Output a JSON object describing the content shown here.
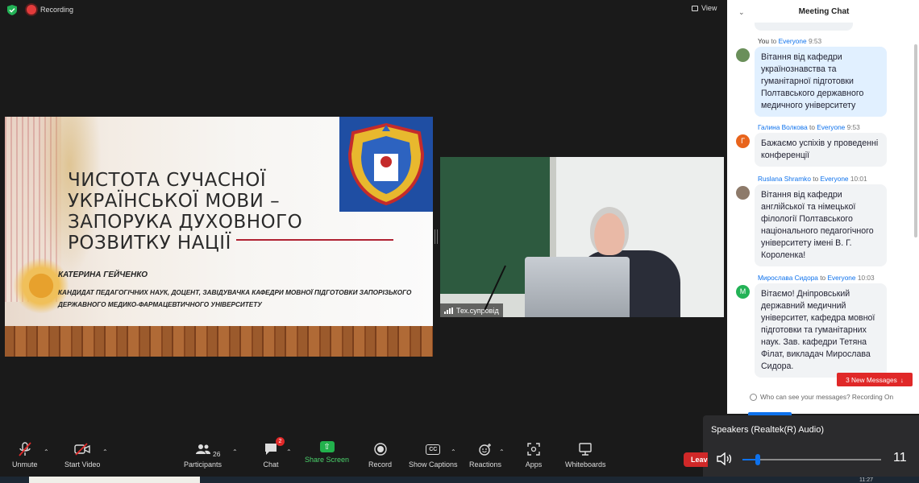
{
  "topbar": {
    "recording_label": "Recording",
    "view_label": "View"
  },
  "slide": {
    "title": "ЧИСТОТА СУЧАСНОЇ УКРАЇНСЬКОЇ МОВИ – ЗАПОРУКА ДУХОВНОГО РОЗВИТКУ НАЦІЇ",
    "author": "КАТЕРИНА ГЕЙЧЕНКО",
    "author_desc": "КАНДИДАТ ПЕДАГОГІЧНИХ НАУК, ДОЦЕНТ, ЗАВІДУВАЧКА КАФЕДРИ МОВНОЇ ПІДГОТОВКИ ЗАПОРІЗЬКОГО ДЕРЖАВНОГО МЕДИКО-ФАРМАЦЕВТИЧНОГО УНІВЕРСИТЕТУ"
  },
  "video": {
    "participant_name": "Тех.супровід"
  },
  "chat": {
    "title": "Meeting Chat",
    "to_word": "to",
    "messages": [
      {
        "sender": "You",
        "recipient": "Everyone",
        "time": "9:53",
        "text": "Вітання від кафедри українознавства та гуманітарної підготовки Полтавського державного медичного університету",
        "avatar_initial": "",
        "avatar_color": "#6a8f5a"
      },
      {
        "sender": "Галина Волкова",
        "recipient": "Everyone",
        "time": "9:53",
        "text": "Бажаємо успіхів у проведенні конференції",
        "avatar_initial": "Г",
        "avatar_color": "#e8641c"
      },
      {
        "sender": "Ruslana Shramko",
        "recipient": "Everyone",
        "time": "10:01",
        "text": "Вітання від кафедри англійської та німецької філології Полтавського національного педагогічного університету імені В. Г. Короленка!",
        "avatar_initial": "",
        "avatar_color": "#8d7a6a"
      },
      {
        "sender": "Мирослава Сидора",
        "recipient": "Everyone",
        "time": "10:03",
        "text": "Вітаємо! Дніпровський державний медичний університет, кафедра мовної підготовки та гуманітарних наук. Зав. кафедри Тетяна Філат, викладач Мирослава Сидора.",
        "avatar_initial": "М",
        "avatar_color": "#23b256"
      }
    ],
    "new_messages_label": "3 New Messages",
    "who_can_see": "Who can see your messages? Recording On"
  },
  "speaker": {
    "device_label": "Speakers (Realtek(R) Audio)",
    "volume_value": "11",
    "volume_fraction": 0.11
  },
  "toolbar": {
    "unmute": "Unmute",
    "start_video": "Start Video",
    "participants": "Participants",
    "participants_count": "26",
    "chat": "Chat",
    "chat_badge": "2",
    "share_screen": "Share Screen",
    "record": "Record",
    "show_captions": "Show Captions",
    "cc_glyph": "CC",
    "reactions": "Reactions",
    "apps": "Apps",
    "whiteboards": "Whiteboards",
    "leave": "Leave"
  },
  "taskbar": {
    "clock": "11:27"
  },
  "colors": {
    "accent_blue": "#0e72ed",
    "share_green": "#22b14c",
    "recording_red": "#e23b3b",
    "leave_red": "#d02828"
  }
}
